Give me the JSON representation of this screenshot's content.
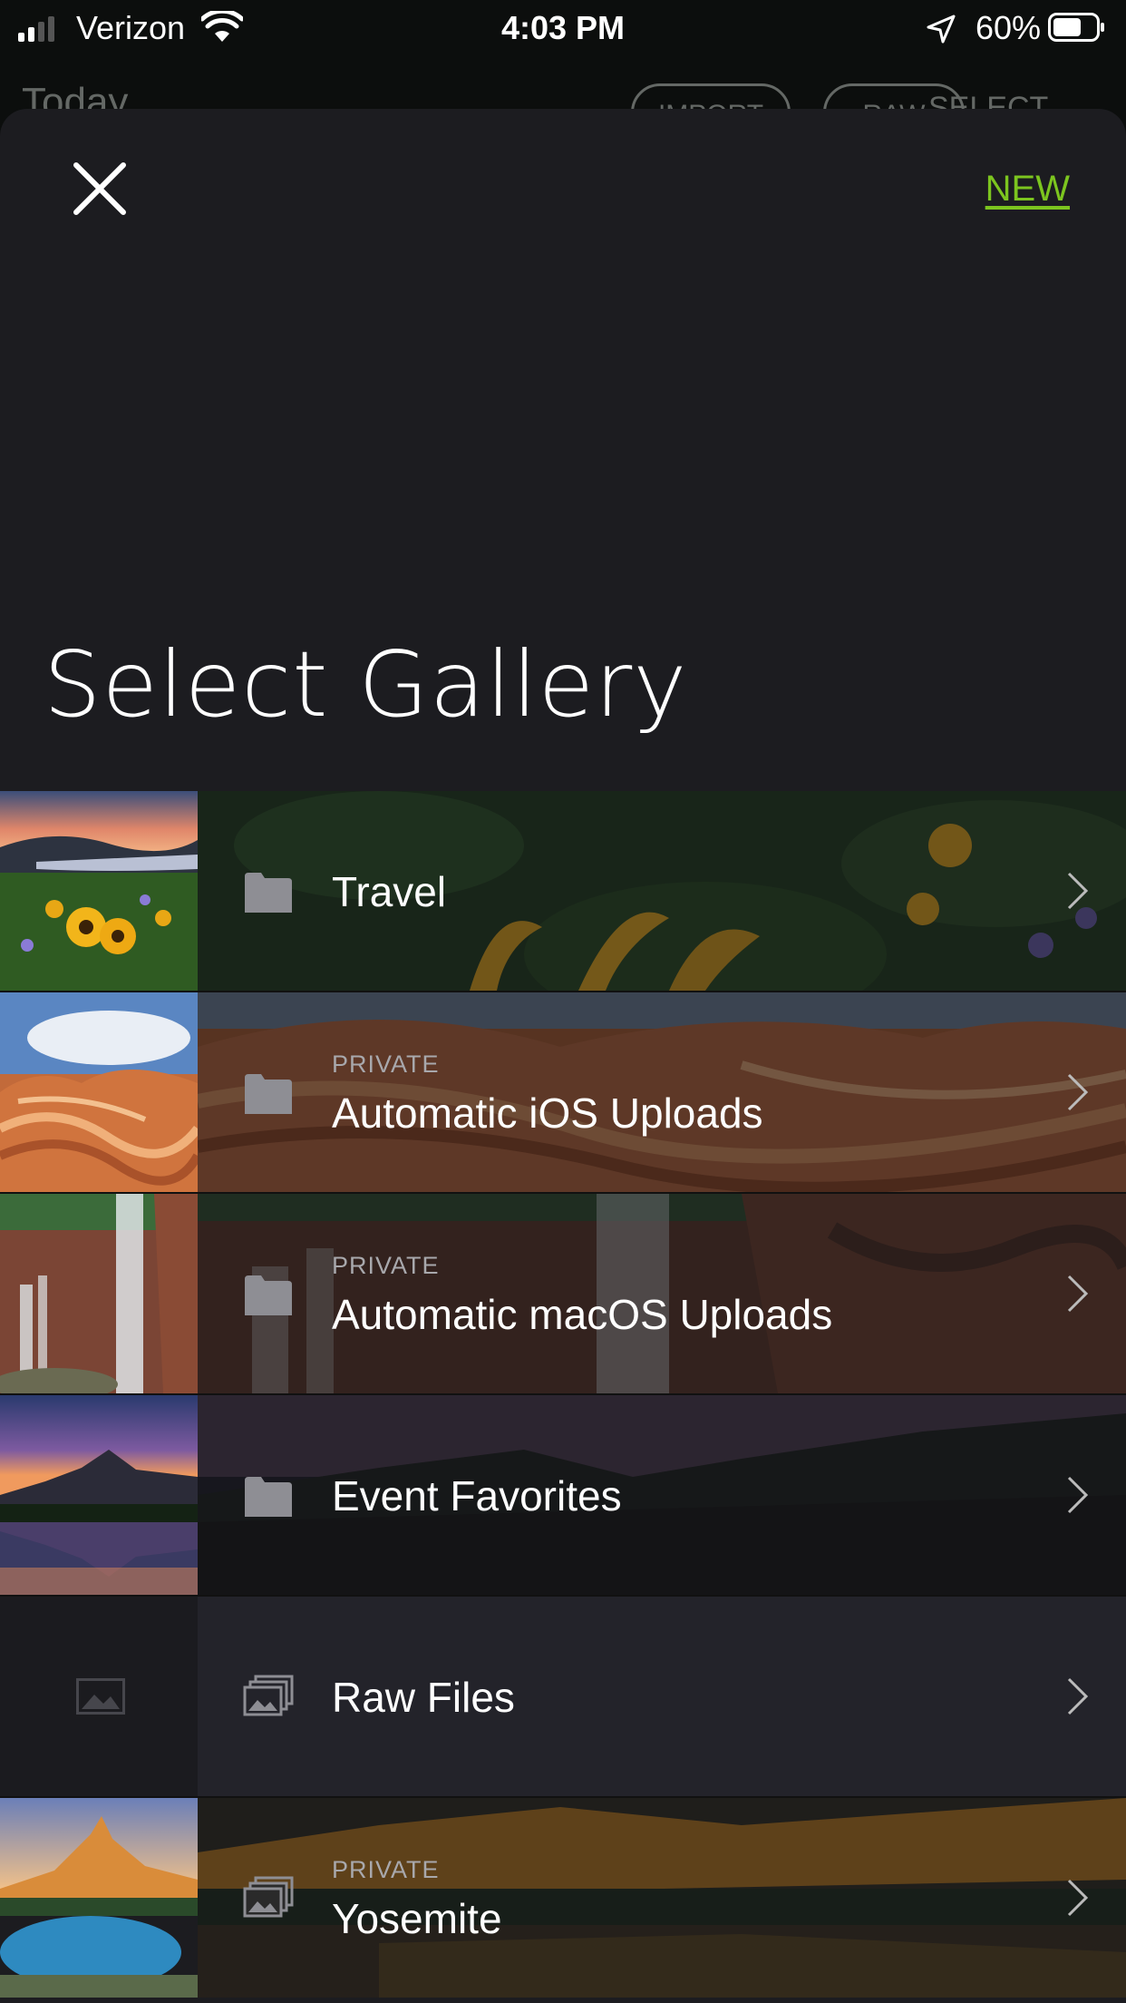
{
  "status_bar": {
    "carrier": "Verizon",
    "time": "4:03 PM",
    "battery": "60%"
  },
  "background_app": {
    "title": "Today",
    "pill_1": "IMPORT",
    "pill_2": "RAW",
    "pill_3": "SELECT"
  },
  "sheet": {
    "new_label": "NEW",
    "title": "Select Gallery"
  },
  "galleries": [
    {
      "name": "Travel",
      "sub": "",
      "icon": "folder-icon"
    },
    {
      "name": "Automatic iOS Uploads",
      "sub": "PRIVATE",
      "icon": "folder-icon"
    },
    {
      "name": "Automatic macOS Uploads",
      "sub": "PRIVATE",
      "icon": "folder-icon"
    },
    {
      "name": "Event Favorites",
      "sub": "",
      "icon": "folder-icon"
    },
    {
      "name": "Raw Files",
      "sub": "",
      "icon": "stacked-photos-icon"
    },
    {
      "name": "Yosemite",
      "sub": "PRIVATE",
      "icon": "stacked-photos-icon"
    }
  ],
  "colors": {
    "accent_new": "#7cc51f",
    "sheet_bg": "#1c1c20"
  }
}
